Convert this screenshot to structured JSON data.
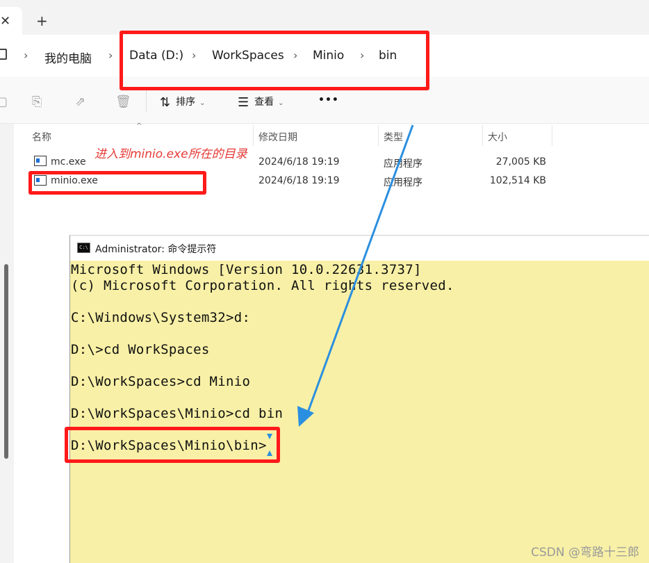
{
  "tabs": {
    "close_glyph": "✕",
    "new_glyph": "+"
  },
  "breadcrumb": {
    "items": [
      "我的电脑",
      "Data (D:)",
      "WorkSpaces",
      "Minio",
      "bin"
    ],
    "separator": "›"
  },
  "toolbar": {
    "sort_label": "排序",
    "view_label": "查看",
    "more_label": "•••"
  },
  "file_list": {
    "columns": [
      "名称",
      "修改日期",
      "类型",
      "大小"
    ],
    "rows": [
      {
        "name": "mc.exe",
        "modified": "2024/6/18 19:19",
        "type": "应用程序",
        "size": "27,005 KB"
      },
      {
        "name": "minio.exe",
        "modified": "2024/6/18 19:19",
        "type": "应用程序",
        "size": "102,514 KB"
      }
    ]
  },
  "annotation": {
    "text": "进入到minio.exe所在的目录",
    "color": "#e53935"
  },
  "cmd": {
    "icon_text": "C:\\",
    "title": "Administrator: 命令提示符",
    "lines": [
      "Microsoft Windows [Version 10.0.22631.3737]",
      "(c) Microsoft Corporation. All rights reserved.",
      "",
      "C:\\Windows\\System32>d:",
      "",
      "D:\\>cd WorkSpaces",
      "",
      "D:\\WorkSpaces>cd Minio",
      "",
      "D:\\WorkSpaces\\Minio>cd bin",
      "",
      "D:\\WorkSpaces\\Minio\\bin>"
    ],
    "background": "#f8f0a6"
  },
  "colors": {
    "highlight": "#ff1a1a",
    "arrow": "#2b8fe0"
  },
  "watermark": "CSDN @弯路十三郎"
}
